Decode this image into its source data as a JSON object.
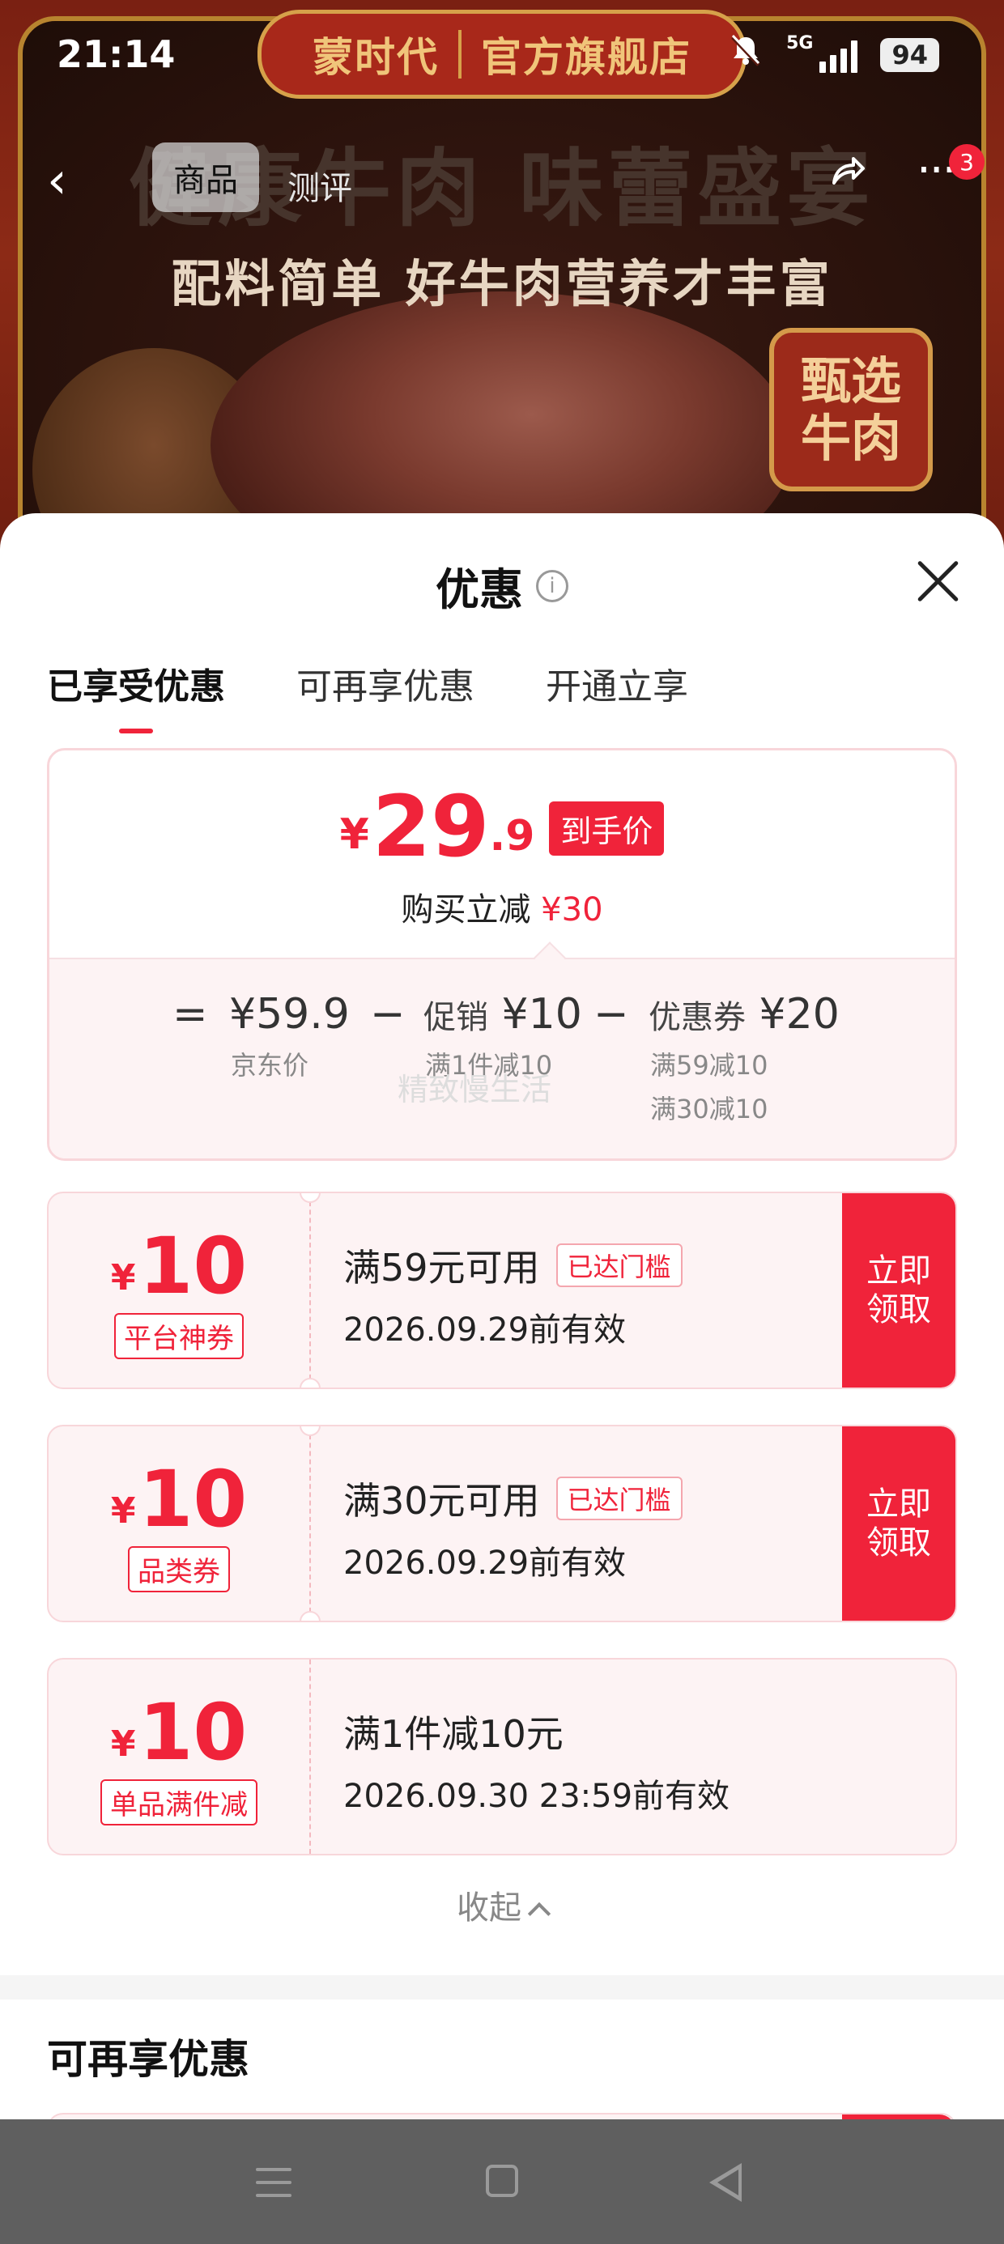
{
  "status_bar": {
    "time": "21:14",
    "network": "5G",
    "battery": "94"
  },
  "banner": {
    "store_brand": "蒙时代",
    "store_type": "官方旗舰店",
    "headline": "健康牛肉 味蕾盛宴",
    "subline": "配料简单 好牛肉营养才丰富",
    "seal_line1": "甄选",
    "seal_line2": "牛肉"
  },
  "nav": {
    "back_icon": "‹",
    "tab_product": "商品",
    "tab_review": "测评",
    "more_icon": "···",
    "badge_count": "3"
  },
  "sheet": {
    "title": "优惠",
    "info_icon": "i",
    "tabs": [
      {
        "label": "已享受优惠"
      },
      {
        "label": "可再享优惠"
      },
      {
        "label": "开通立享"
      }
    ],
    "summary": {
      "currency": "¥",
      "price_int": "29",
      "price_dec": ".9",
      "price_tag": "到手价",
      "save_prefix": "购买立减",
      "save_amount": "¥30",
      "eq": "=",
      "minus": "−",
      "base_price": "¥59.9",
      "base_label": "京东价",
      "promo_label": "促销",
      "promo_amount": "¥10",
      "promo_note": "满1件减10",
      "coupon_label": "优惠券",
      "coupon_amount": "¥20",
      "coupon_note1": "满59减10",
      "coupon_note2": "满30减10",
      "watermark": "精致慢生活"
    },
    "coupons": [
      {
        "currency": "¥",
        "amount": "10",
        "type": "平台神券",
        "condition": "满59元可用",
        "badge": "已达门槛",
        "expiry": "2026.09.29前有效",
        "button_line1": "立即",
        "button_line2": "领取"
      },
      {
        "currency": "¥",
        "amount": "10",
        "type": "品类券",
        "condition": "满30元可用",
        "badge": "已达门槛",
        "expiry": "2026.09.29前有效",
        "button_line1": "立即",
        "button_line2": "领取"
      },
      {
        "currency": "¥",
        "amount": "10",
        "type": "单品满件减",
        "condition": "满1件减10元",
        "expiry": "2026.09.30 23:59前有效"
      }
    ],
    "collapse_label": "收起",
    "section_more_title": "可再享优惠"
  },
  "colors": {
    "accent": "#f0233a",
    "card_bg": "#fdf3f4",
    "card_border": "#f8d6da",
    "banner_red": "#8c2a16",
    "gold": "#d6a14a"
  }
}
